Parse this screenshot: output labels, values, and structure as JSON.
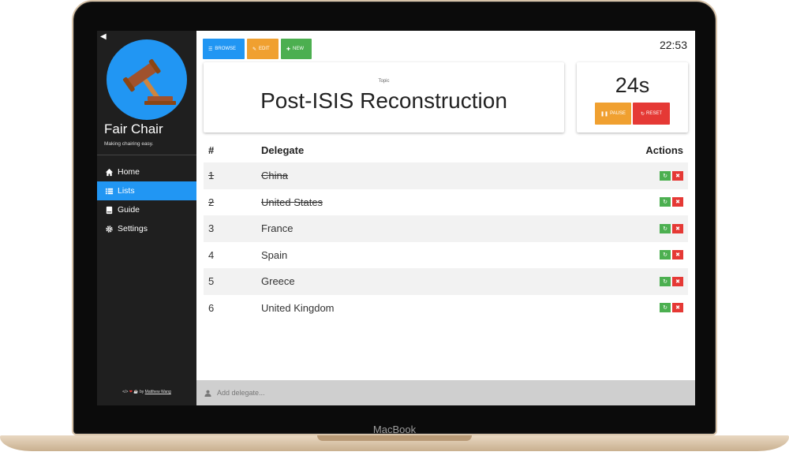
{
  "device": {
    "brand": "MacBook"
  },
  "sidebar": {
    "app_name": "Fair Chair",
    "tagline": "Making chairing easy.",
    "items": [
      {
        "label": "Home",
        "icon": "home-icon",
        "active": false
      },
      {
        "label": "Lists",
        "icon": "list-icon",
        "active": true
      },
      {
        "label": "Guide",
        "icon": "book-icon",
        "active": false
      },
      {
        "label": "Settings",
        "icon": "gear-icon",
        "active": false
      }
    ],
    "credit": {
      "prefix": "by",
      "author": "Matthew Wang"
    }
  },
  "toolbar": {
    "browse_label": "BROWSE",
    "edit_label": "EDIT",
    "new_label": "NEW"
  },
  "clock": "22:53",
  "topic": {
    "label": "Topic",
    "title": "Post-ISIS Reconstruction"
  },
  "timer": {
    "value": "24s",
    "pause_label": "PAUSE",
    "reset_label": "RESET"
  },
  "table": {
    "headers": {
      "num": "#",
      "delegate": "Delegate",
      "actions": "Actions"
    },
    "rows": [
      {
        "num": "1",
        "delegate": "China",
        "done": true
      },
      {
        "num": "2",
        "delegate": "United States",
        "done": true
      },
      {
        "num": "3",
        "delegate": "France",
        "done": false
      },
      {
        "num": "4",
        "delegate": "Spain",
        "done": false
      },
      {
        "num": "5",
        "delegate": "Greece",
        "done": false
      },
      {
        "num": "6",
        "delegate": "United Kingdom",
        "done": false
      }
    ]
  },
  "add_delegate": {
    "placeholder": "Add delegate..."
  },
  "colors": {
    "accent": "#2196f3",
    "warning": "#f0a030",
    "danger": "#e53935",
    "success": "#4caf50",
    "sidebar": "#1f1f1f"
  }
}
